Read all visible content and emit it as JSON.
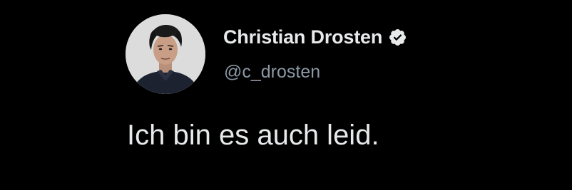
{
  "tweet": {
    "author": {
      "display_name": "Christian Drosten",
      "handle": "@c_drosten",
      "verified_icon": "verified-badge-icon",
      "avatar": "profile-photo"
    },
    "text": "Ich bin es auch leid."
  },
  "colors": {
    "background": "#000000",
    "primary_text": "#e7e9ea",
    "secondary_text": "#8b98a5",
    "badge_fill": "#e7e9ea",
    "badge_check": "#000000"
  }
}
